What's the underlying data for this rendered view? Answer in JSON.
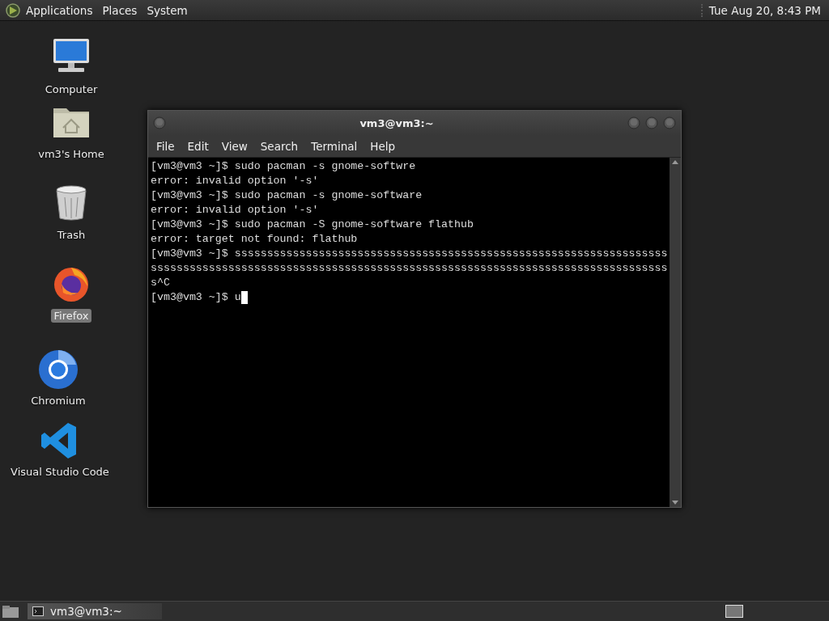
{
  "top_panel": {
    "menus": [
      "Applications",
      "Places",
      "System"
    ],
    "clock": "Tue Aug 20, 8:43 PM"
  },
  "desktop_icons": [
    {
      "kind": "computer",
      "label": "Computer",
      "selected": false
    },
    {
      "kind": "home",
      "label": "vm3's Home",
      "selected": false
    },
    {
      "kind": "trash",
      "label": "Trash",
      "selected": false
    },
    {
      "kind": "firefox",
      "label": "Firefox",
      "selected": true
    },
    {
      "kind": "chromium",
      "label": "Chromium",
      "selected": false
    },
    {
      "kind": "vscode",
      "label": "Visual Studio Code",
      "selected": false
    }
  ],
  "terminal_window": {
    "title": "vm3@vm3:~",
    "menus": [
      "File",
      "Edit",
      "View",
      "Search",
      "Terminal",
      "Help"
    ],
    "lines": [
      "[vm3@vm3 ~]$ sudo pacman -s gnome-softwre",
      "error: invalid option '-s'",
      "[vm3@vm3 ~]$ sudo pacman -s gnome-software",
      "error: invalid option '-s'",
      "[vm3@vm3 ~]$ sudo pacman -S gnome-software flathub",
      "error: target not found: flathub",
      "[vm3@vm3 ~]$ sssssssssssssssssssssssssssssssssssssssssssssssssssssssssssssssssss",
      "ssssssssssssssssssssssssssssssssssssssssssssssssssssssssssssssssssssssssssssssss",
      "s^C",
      "[vm3@vm3 ~]$ u"
    ]
  },
  "taskbar": {
    "tasks": [
      "vm3@vm3:~"
    ]
  }
}
